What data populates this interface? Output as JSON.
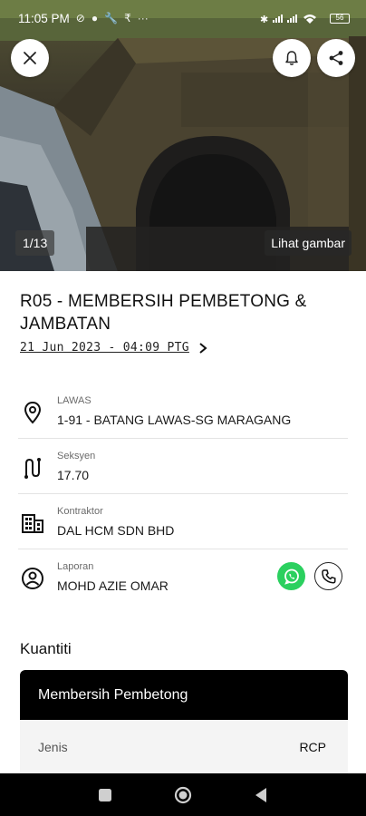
{
  "status_bar": {
    "time": "11:05 PM",
    "battery": "56"
  },
  "hero": {
    "counter": "1/13",
    "view_photo_label": "Lihat gambar"
  },
  "report": {
    "title": "R05 - MEMBERSIH PEMBETONG & JAMBATAN",
    "date": "21 Jun 2023 - 04:09 PTG"
  },
  "details": [
    {
      "label": "LAWAS",
      "value": "1-91 - BATANG LAWAS-SG MARAGANG",
      "icon": "location-pin-icon"
    },
    {
      "label": "Seksyen",
      "value": "17.70",
      "icon": "route-icon"
    },
    {
      "label": "Kontraktor",
      "value": "DAL HCM SDN BHD",
      "icon": "building-icon"
    },
    {
      "label": "Laporan",
      "value": "MOHD AZIE OMAR",
      "icon": "user-circle-icon"
    }
  ],
  "quantity": {
    "section_title": "Kuantiti",
    "card_title": "Membersih Pembetong",
    "rows": [
      {
        "key": "Jenis",
        "value": "RCP"
      }
    ]
  },
  "colors": {
    "whatsapp": "#2bd05f",
    "card_header": "#000000",
    "card_body": "#f4f4f4"
  }
}
